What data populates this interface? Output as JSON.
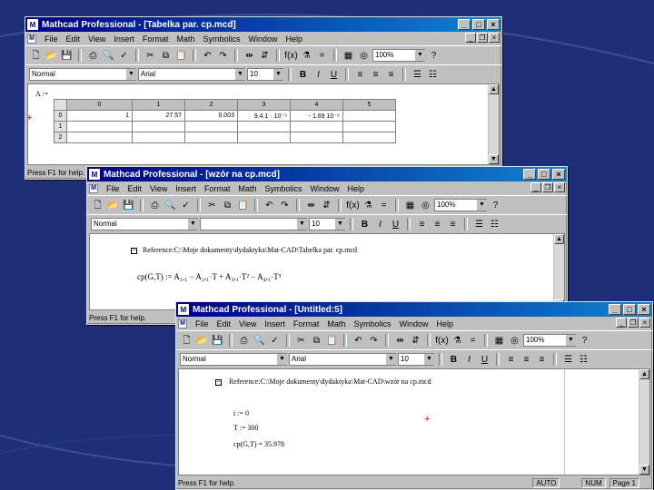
{
  "app_name": "Mathcad Professional",
  "menu": [
    "File",
    "Edit",
    "View",
    "Insert",
    "Format",
    "Math",
    "Symbolics",
    "Window",
    "Help"
  ],
  "status_help": "Press F1 for help.",
  "windows": [
    {
      "title": "Mathcad Professional - [Tabelka par. cp.mcd]",
      "style": "Normal",
      "font": "Arial",
      "size": "10",
      "zoom": "100%",
      "matrix_label": "A :=",
      "table": {
        "headers": [
          "",
          "0",
          "1",
          "2",
          "3",
          "4",
          "5"
        ],
        "rows": [
          [
            "0",
            "1",
            "27.57",
            "0.003",
            "9.4.1 · 10⁻⁵",
            "- 1.69 10⁻⁹",
            ""
          ],
          [
            "1",
            "",
            "",
            "",
            "",
            "",
            ""
          ],
          [
            "2",
            "",
            "",
            "",
            "",
            "",
            ""
          ]
        ]
      }
    },
    {
      "title": "Mathcad Professional - [wzór na cp.mcd]",
      "style": "Normal",
      "font": "",
      "size": "10",
      "zoom": "100%",
      "reference": "Reference:C:\\Moje dokumenty\\dydaktyka\\Mat-CAD\\Tabelka par. cp.mcd",
      "formula": "cp(G,T) := A₁,₁ − A₂,₁·T + A₃,₁·T² − A₄,₁·T³"
    },
    {
      "title": "Mathcad Professional - [Untitled:5]",
      "style": "Normal",
      "font": "Arial",
      "size": "10",
      "zoom": "100%",
      "reference": "Reference:C:\\Moje dokumenty\\dydaktyka\\Mat-CAD\\wzór na cp.mcd",
      "lines": [
        "i := 0",
        "T := 300",
        "cp(G,T) = 35.978"
      ],
      "status_auto": "AUTO",
      "status_num": "NUM",
      "status_page": "Page 1"
    }
  ]
}
